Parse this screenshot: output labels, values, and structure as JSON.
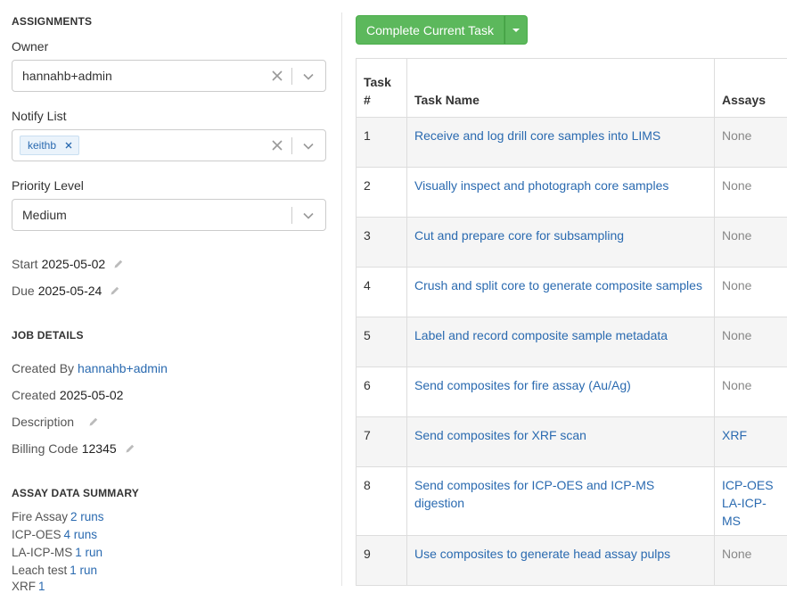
{
  "assignments": {
    "section_title": "ASSIGNMENTS",
    "owner": {
      "label": "Owner",
      "value": "hannahb+admin"
    },
    "notify_list": {
      "label": "Notify List",
      "tags": [
        "keithb"
      ]
    },
    "priority": {
      "label": "Priority Level",
      "value": "Medium"
    },
    "start": {
      "label": "Start",
      "value": "2025-05-02"
    },
    "due": {
      "label": "Due",
      "value": "2025-05-24"
    }
  },
  "job_details": {
    "section_title": "JOB DETAILS",
    "created_by": {
      "label": "Created By",
      "value": "hannahb+admin"
    },
    "created": {
      "label": "Created",
      "value": "2025-05-02"
    },
    "description": {
      "label": "Description",
      "value": ""
    },
    "billing_code": {
      "label": "Billing Code",
      "value": "12345"
    }
  },
  "assay_summary": {
    "section_title": "ASSAY DATA SUMMARY",
    "items": [
      {
        "label": "Fire Assay",
        "value": "2 runs"
      },
      {
        "label": "ICP-OES",
        "value": "4 runs"
      },
      {
        "label": "LA-ICP-MS",
        "value": "1 run"
      },
      {
        "label": "Leach test",
        "value": "1 run"
      },
      {
        "label": "XRF",
        "value": "1"
      }
    ]
  },
  "actions": {
    "complete_label": "Complete Current Task"
  },
  "tasks_table": {
    "headers": {
      "num": "Task #",
      "name": "Task Name",
      "assays": "Assays"
    },
    "rows": [
      {
        "num": "1",
        "name": "Receive and log drill core samples into LIMS",
        "assays": "None"
      },
      {
        "num": "2",
        "name": "Visually inspect and photograph core samples",
        "assays": "None"
      },
      {
        "num": "3",
        "name": "Cut and prepare core for subsampling",
        "assays": "None"
      },
      {
        "num": "4",
        "name": "Crush and split core to generate composite samples",
        "assays": "None"
      },
      {
        "num": "5",
        "name": "Label and record composite sample metadata",
        "assays": "None"
      },
      {
        "num": "6",
        "name": "Send composites for fire assay (Au/Ag)",
        "assays": "None"
      },
      {
        "num": "7",
        "name": "Send composites for XRF scan",
        "assays": "XRF"
      },
      {
        "num": "8",
        "name": "Send composites for ICP-OES and ICP-MS digestion",
        "assays": "ICP-OES LA-ICP-MS"
      },
      {
        "num": "9",
        "name": "Use composites to generate head assay pulps",
        "assays": "None"
      }
    ]
  },
  "colors": {
    "accent_green": "#5cb85c",
    "link_blue": "#2a6ab0",
    "row_stripe": "#f5f5f5"
  }
}
